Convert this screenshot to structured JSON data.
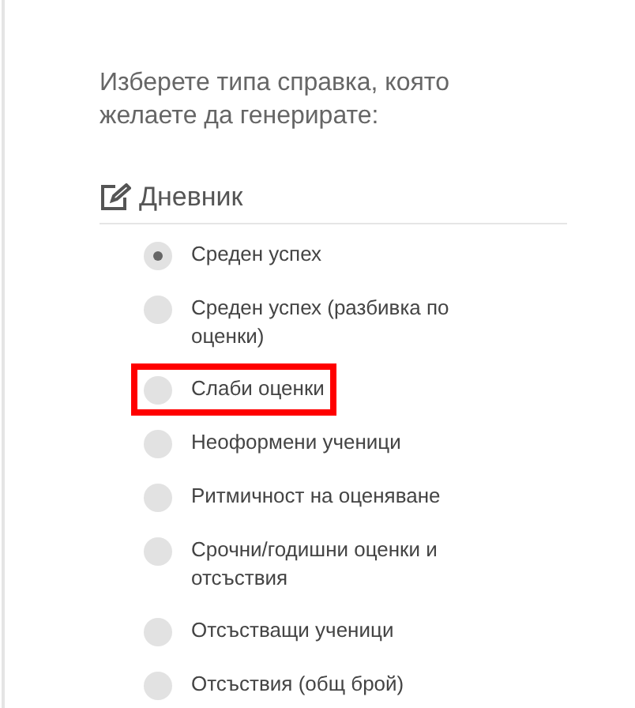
{
  "prompt": "Изберете типа справка, която желаете да генерирате:",
  "section": {
    "title": "Дневник"
  },
  "options": [
    {
      "label": "Среден успех",
      "selected": true,
      "highlighted": false
    },
    {
      "label": "Среден успех (разбивка по оценки)",
      "selected": false,
      "highlighted": false
    },
    {
      "label": "Слаби оценки",
      "selected": false,
      "highlighted": true
    },
    {
      "label": "Неоформени ученици",
      "selected": false,
      "highlighted": false
    },
    {
      "label": "Ритмичност на оценяване",
      "selected": false,
      "highlighted": false
    },
    {
      "label": "Срочни/годишни оценки и отсъствия",
      "selected": false,
      "highlighted": false
    },
    {
      "label": "Отсъстващи ученици",
      "selected": false,
      "highlighted": false
    },
    {
      "label": "Отсъствия (общ брой)",
      "selected": false,
      "highlighted": false
    }
  ]
}
